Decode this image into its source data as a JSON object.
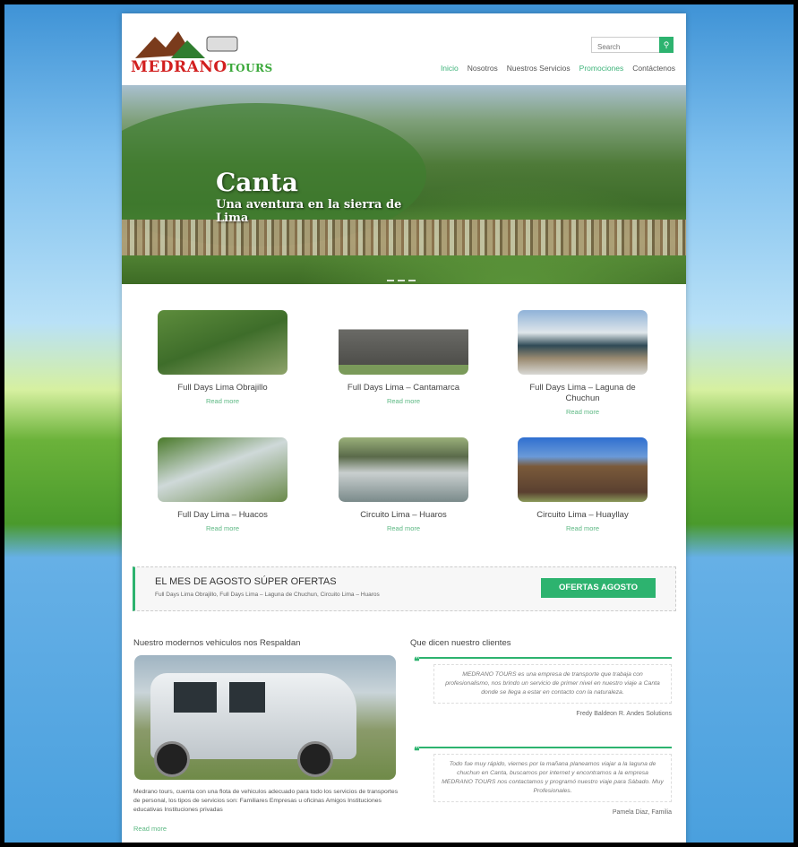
{
  "header": {
    "logo_main": "MEDRANO",
    "logo_accent": "TOURS",
    "search_placeholder": "Search",
    "nav": [
      {
        "label": "Inicio"
      },
      {
        "label": "Nosotros"
      },
      {
        "label": "Nuestros Servicios"
      },
      {
        "label": "Promociones"
      },
      {
        "label": "Contáctenos"
      }
    ]
  },
  "hero": {
    "title": "Canta",
    "subtitle": "Una aventura en la sierra de Lima"
  },
  "tours": [
    {
      "title": "Full Days Lima Obrajillo",
      "link": "Read more"
    },
    {
      "title": "Full Days Lima – Cantamarca",
      "link": "Read more"
    },
    {
      "title": "Full Days Lima – Laguna de Chuchun",
      "link": "Read more"
    },
    {
      "title": "Full Day Lima – Huacos",
      "link": "Read more"
    },
    {
      "title": "Circuito Lima – Huaros",
      "link": "Read more"
    },
    {
      "title": "Circuito Lima – Huayllay",
      "link": "Read more"
    }
  ],
  "promo": {
    "heading": "EL MES DE AGOSTO SÚPER OFERTAS",
    "sub": "Full Days Lima Obrajillo, Full Days Lima – Laguna de Chuchun, Circuito Lima – Huaros",
    "button": "OFERTAS AGOSTO"
  },
  "vehicles": {
    "title": "Nuestro modernos vehiculos nos Respaldan",
    "description": "Medrano tours, cuenta con una flota de vehiculos adecuado para todo los servicios de transportes de personal, los tipos de servicios son: Familiares Empresas u oficinas Amigos Instituciones educativas Instituciones privadas",
    "link": "Read more"
  },
  "testimonials": {
    "title": "Que dicen nuestro clientes",
    "items": [
      {
        "text": "MEDRANO TOURS es una empresa de transporte que trabaja con profesionalismo, nos brindo un servicio de primer nivel en nuestro viaje a Canta donde se llega a estar en contacto con la naturaleza.",
        "author": "Fredy Baldeon R. Andes Solutions"
      },
      {
        "text": "Todo fue muy rápido, viernes por la mañana planeamos viajar a la laguna de chuchun en Canta, buscamos por internet y encontramos a la empresa MEDRANO TOURS nos contactamos y programó nuestro viaje para Sábado. Muy Profesionales.",
        "author": "Pamela Diaz, Familia"
      }
    ]
  },
  "colors": {
    "accent": "#2db36f",
    "logo_red": "#d21f1f"
  }
}
